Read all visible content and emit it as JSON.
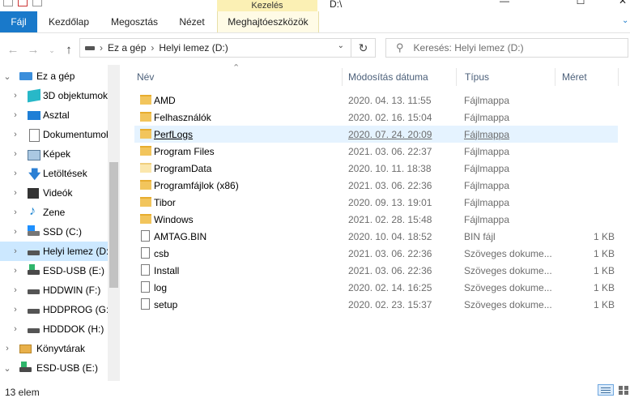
{
  "window": {
    "title": "D:\\",
    "context_tab_group": "Kezelés",
    "controls": {
      "minimize": "—",
      "maximize": "☐",
      "close": "✕"
    }
  },
  "ribbon": {
    "tabs": [
      {
        "label": "Fájl",
        "active": true
      },
      {
        "label": "Kezdőlap"
      },
      {
        "label": "Megosztás"
      },
      {
        "label": "Nézet"
      },
      {
        "label": "Meghajtóeszközök"
      }
    ],
    "collapse_icon": "chevron-down-icon"
  },
  "address": {
    "breadcrumbs": [
      "Ez a gép",
      "Helyi lemez (D:)"
    ],
    "separator": "›",
    "search_placeholder": "Keresés: Helyi lemez (D:)"
  },
  "nav": {
    "items": [
      {
        "label": "Ez a gép",
        "icon": "computer-icon",
        "expanded": true
      },
      {
        "label": "3D objektumok",
        "icon": "3d-objects-icon"
      },
      {
        "label": "Asztal",
        "icon": "desktop-icon"
      },
      {
        "label": "Dokumentumok",
        "icon": "documents-icon"
      },
      {
        "label": "Képek",
        "icon": "pictures-icon"
      },
      {
        "label": "Letöltések",
        "icon": "downloads-icon"
      },
      {
        "label": "Videók",
        "icon": "videos-icon"
      },
      {
        "label": "Zene",
        "icon": "music-icon"
      },
      {
        "label": "SSD (C:)",
        "icon": "system-drive-icon"
      },
      {
        "label": "Helyi lemez (D:)",
        "icon": "drive-icon",
        "selected": true
      },
      {
        "label": "ESD-USB (E:)",
        "icon": "usb-drive-icon"
      },
      {
        "label": "HDDWIN (F:)",
        "icon": "drive-icon"
      },
      {
        "label": "HDDPROG (G:)",
        "icon": "drive-icon"
      },
      {
        "label": "HDDDOK (H:)",
        "icon": "drive-icon"
      },
      {
        "label": "Könyvtárak",
        "icon": "libraries-icon"
      },
      {
        "label": "ESD-USB (E:)",
        "icon": "usb-drive-icon",
        "expanded": true
      }
    ]
  },
  "list": {
    "columns": {
      "name": "Név",
      "modified": "Módosítás dátuma",
      "type": "Típus",
      "size": "Méret"
    },
    "rows": [
      {
        "name": "AMD",
        "date": "2020. 04. 13. 11:55",
        "type": "Fájlmappa",
        "size": "",
        "icon": "folder-icon"
      },
      {
        "name": "Felhasználók",
        "date": "2020. 02. 16. 15:04",
        "type": "Fájlmappa",
        "size": "",
        "icon": "folder-icon"
      },
      {
        "name": "PerfLogs",
        "date": "2020. 07. 24. 20:09",
        "type": "Fájlmappa",
        "size": "",
        "icon": "folder-icon",
        "hover": true
      },
      {
        "name": "Program Files",
        "date": "2021. 03. 06. 22:37",
        "type": "Fájlmappa",
        "size": "",
        "icon": "folder-icon"
      },
      {
        "name": "ProgramData",
        "date": "2020. 10. 11. 18:38",
        "type": "Fájlmappa",
        "size": "",
        "icon": "hidden-folder-icon"
      },
      {
        "name": "Programfájlok (x86)",
        "date": "2021. 03. 06. 22:36",
        "type": "Fájlmappa",
        "size": "",
        "icon": "folder-icon"
      },
      {
        "name": "Tibor",
        "date": "2020. 09. 13. 19:01",
        "type": "Fájlmappa",
        "size": "",
        "icon": "folder-icon"
      },
      {
        "name": "Windows",
        "date": "2021. 02. 28. 15:48",
        "type": "Fájlmappa",
        "size": "",
        "icon": "folder-icon"
      },
      {
        "name": "AMTAG.BIN",
        "date": "2020. 10. 04. 18:52",
        "type": "BIN fájl",
        "size": "1 KB",
        "icon": "file-icon"
      },
      {
        "name": "csb",
        "date": "2021. 03. 06. 22:36",
        "type": "Szöveges dokume...",
        "size": "1 KB",
        "icon": "text-file-icon"
      },
      {
        "name": "Install",
        "date": "2021. 03. 06. 22:36",
        "type": "Szöveges dokume...",
        "size": "1 KB",
        "icon": "text-file-icon"
      },
      {
        "name": "log",
        "date": "2020. 02. 14. 16:25",
        "type": "Szöveges dokume...",
        "size": "1 KB",
        "icon": "text-file-icon"
      },
      {
        "name": "setup",
        "date": "2020. 02. 23. 15:37",
        "type": "Szöveges dokume...",
        "size": "1 KB",
        "icon": "text-file-icon"
      }
    ]
  },
  "status": {
    "count": "13 elem"
  },
  "colors": {
    "accent": "#1979ca",
    "selected": "#cce8ff",
    "hover": "#e5f3ff",
    "context_tab": "#fbf0b4"
  }
}
